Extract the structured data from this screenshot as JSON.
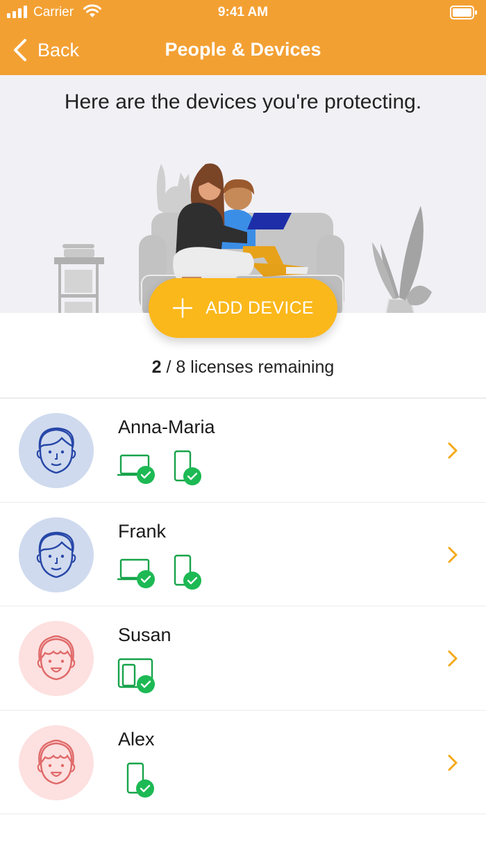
{
  "status_bar": {
    "carrier": "Carrier",
    "time": "9:41 AM"
  },
  "nav": {
    "back_label": "Back",
    "title": "People & Devices"
  },
  "hero": {
    "heading": "Here are the devices you're protecting."
  },
  "add_button": {
    "label": "ADD DEVICE"
  },
  "licenses": {
    "used": "2",
    "rest": " / 8 licenses remaining"
  },
  "people": [
    {
      "name": "Anna-Maria",
      "avatar": "male-face",
      "devices": [
        "laptop-protected-icon",
        "phone-protected-icon"
      ]
    },
    {
      "name": "Frank",
      "avatar": "male-face",
      "devices": [
        "laptop-protected-icon",
        "phone-protected-icon"
      ]
    },
    {
      "name": "Susan",
      "avatar": "female-face",
      "devices": [
        "tablet-phone-protected-icon"
      ]
    },
    {
      "name": "Alex",
      "avatar": "female-face",
      "devices": [
        "phone-protected-icon"
      ]
    }
  ],
  "colors": {
    "header": "#f3a033",
    "accent": "#fbb81b",
    "protected_green": "#1db954",
    "device_green": "#17a34a",
    "avatar_blue": "#cfdaee",
    "avatar_pink": "#fde0e0"
  }
}
